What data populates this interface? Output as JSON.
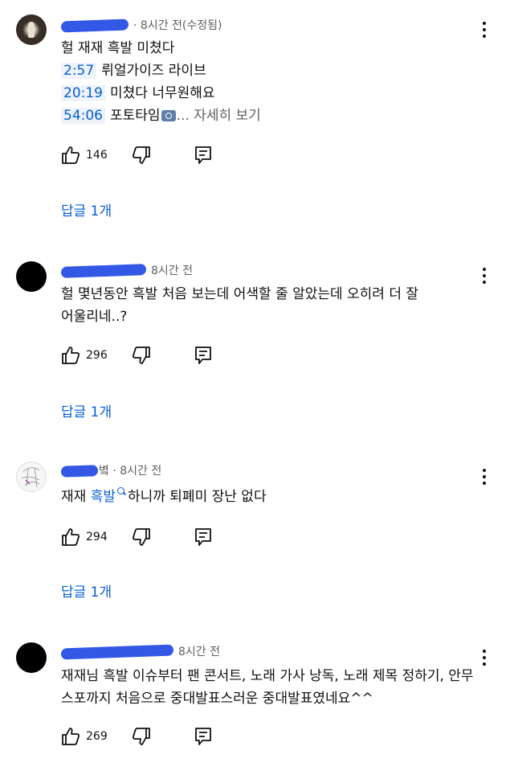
{
  "comments": [
    {
      "avatar": "photo",
      "time": "8시간 전(수정됨)",
      "separator": "·",
      "text_line1": "헐 재재 흑발 미쳤다",
      "timestamps": [
        {
          "time": "2:57",
          "label": "뤼얼가이즈 라이브"
        },
        {
          "time": "20:19",
          "label": "미쳤다 너무원해요"
        },
        {
          "time": "54:06",
          "label": "포토타임"
        }
      ],
      "more_label": "... 자세히 보기",
      "likes": "146",
      "reply_label": "답글 1개"
    },
    {
      "avatar": "black",
      "time": "8시간 전",
      "separator": "·",
      "text_line1": "헐 몇년동안 흑발 처음 보는데 어색할 줄 알았는데 오히려 더 잘",
      "text_line2": "어울리네..?",
      "likes": "296",
      "reply_label": "답글 1개"
    },
    {
      "avatar": "sketch",
      "name_suffix": "볔",
      "time": "8시간 전",
      "separator": "·",
      "text_pre": "재재",
      "text_link": "흑발",
      "text_post": "하니까 퇴폐미 장난 없다",
      "likes": "294",
      "reply_label": "답글 1개"
    },
    {
      "avatar": "black",
      "time": "8시간 전",
      "separator": "·",
      "text_line1": "재재님 흑발 이슈부터 팬 콘서트, 노래 가사 낭독, 노래 제목 정하기, 안무",
      "text_line2": "스포까지 처음으로 중대발표스러운 중대발표였네요^^",
      "likes": "269"
    }
  ],
  "icons": {
    "like": "thumbs-up-icon",
    "dislike": "thumbs-down-icon",
    "reply": "comment-reply-icon",
    "menu": "more-vert-icon",
    "camera": "camera-emoji-icon",
    "search": "search-icon"
  },
  "colors": {
    "link": "#065fd4",
    "meta": "#606060",
    "redaction": "#3358e6"
  }
}
